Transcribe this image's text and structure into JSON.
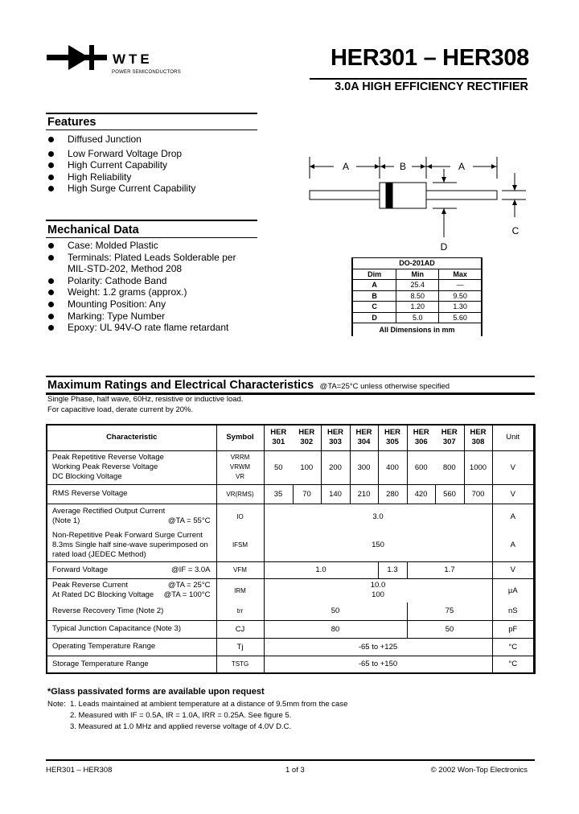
{
  "header": {
    "brand": "WTE",
    "brand_tagline": "POWER SEMICONDUCTORS",
    "title": "HER301 – HER308",
    "subtitle": "3.0A HIGH EFFICIENCY RECTIFIER"
  },
  "features": {
    "heading": "Features",
    "items": [
      "Diffused Junction",
      "Low Forward Voltage Drop",
      "High Current Capability",
      "High Reliability",
      "High Surge Current Capability"
    ]
  },
  "mechanical": {
    "heading": "Mechanical Data",
    "items": [
      "Case: Molded Plastic",
      "Terminals: Plated Leads Solderable per MIL-STD-202, Method 208",
      "Polarity: Cathode Band",
      "Weight: 1.2 grams (approx.)",
      "Mounting Position: Any",
      "Marking: Type Number",
      "Epoxy: UL 94V-O rate flame retardant"
    ]
  },
  "diagram": {
    "labels": {
      "a": "A",
      "b": "B",
      "c": "C",
      "d": "D"
    }
  },
  "dimensions": {
    "package": "DO-201AD",
    "headers": [
      "Dim",
      "Min",
      "Max"
    ],
    "rows": [
      [
        "A",
        "25.4",
        "—"
      ],
      [
        "B",
        "8.50",
        "9.50"
      ],
      [
        "C",
        "1.20",
        "1.30"
      ],
      [
        "D",
        "5.0",
        "5.60"
      ]
    ],
    "footer": "All Dimensions in mm"
  },
  "ratings": {
    "heading": "Maximum Ratings and Electrical Characteristics",
    "condition": "@TA=25°C unless otherwise specified",
    "intro1": "Single Phase, half wave, 60Hz, resistive or inductive load.",
    "intro2": "For capacitive load, derate current by 20%.",
    "col_char": "Characteristic",
    "col_symbol": "Symbol",
    "col_unit": "Unit",
    "parts": [
      [
        "HER",
        "301"
      ],
      [
        "HER",
        "302"
      ],
      [
        "HER",
        "303"
      ],
      [
        "HER",
        "304"
      ],
      [
        "HER",
        "305"
      ],
      [
        "HER",
        "306"
      ],
      [
        "HER",
        "307"
      ],
      [
        "HER",
        "308"
      ]
    ],
    "rows": {
      "vrrm": {
        "chars": [
          "Peak Repetitive Reverse Voltage",
          "Working Peak Reverse Voltage",
          "DC Blocking Voltage"
        ],
        "symbols": [
          "VRRM",
          "VRWM",
          "VR"
        ],
        "values": [
          "50",
          "100",
          "200",
          "300",
          "400",
          "600",
          "800",
          "1000"
        ],
        "unit": "V"
      },
      "vrms": {
        "char": "RMS Reverse Voltage",
        "symbol": "VR(RMS)",
        "values": [
          "35",
          "70",
          "140",
          "210",
          "280",
          "420",
          "560",
          "700"
        ],
        "unit": "V"
      },
      "io": {
        "char1": "Average Rectified Output Current",
        "char2": "(Note 1)",
        "cond": "@TA = 55°C",
        "symbol": "IO",
        "value": "3.0",
        "unit": "A"
      },
      "ifsm": {
        "chars": [
          "Non-Repetitive Peak Forward Surge Current",
          "8.3ms Single half sine-wave superimposed on",
          "rated load (JEDEC Method)"
        ],
        "symbol": "IFSM",
        "value": "150",
        "unit": "A"
      },
      "vfm": {
        "char": "Forward Voltage",
        "cond": "@IF = 3.0A",
        "symbol": "VFM",
        "values": [
          "1.0",
          "1.3",
          "1.7"
        ],
        "unit": "V"
      },
      "irm": {
        "char1": "Peak Reverse Current",
        "cond1": "@TA = 25°C",
        "char2": "At Rated DC Blocking Voltage",
        "cond2": "@TA = 100°C",
        "symbol": "IRM",
        "value1": "10.0",
        "value2": "100",
        "unit": "µA"
      },
      "trr": {
        "char": "Reverse Recovery Time (Note 2)",
        "symbol": "trr",
        "values": [
          "50",
          "75"
        ],
        "unit": "nS"
      },
      "cj": {
        "char": "Typical Junction Capacitance (Note 3)",
        "symbol": "CJ",
        "values": [
          "80",
          "50"
        ],
        "unit": "pF"
      },
      "tj": {
        "char": "Operating Temperature Range",
        "symbol": "Tj",
        "value": "-65 to +125",
        "unit": "°C"
      },
      "tstg": {
        "char": "Storage Temperature Range",
        "symbol": "TSTG",
        "value": "-65 to +150",
        "unit": "°C"
      }
    }
  },
  "notes": {
    "glass": "*Glass passivated forms are available upon request",
    "label": "Note:",
    "items": [
      "1. Leads maintained at ambient temperature at a distance of 9.5mm from the case",
      "2. Measured with IF = 0.5A, IR = 1.0A, IRR = 0.25A. See figure 5.",
      "3. Measured at 1.0 MHz and applied reverse voltage of 4.0V D.C."
    ]
  },
  "footer": {
    "left": "HER301 – HER308",
    "center": "1 of 3",
    "right": "© 2002 Won-Top Electronics"
  }
}
